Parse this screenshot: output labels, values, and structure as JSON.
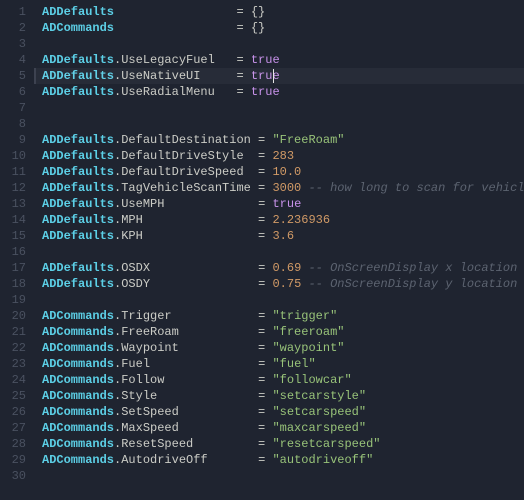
{
  "editor": {
    "cursor_line": 5,
    "cursor_col_ch": 33,
    "lines": [
      {
        "n": 1,
        "tokens": [
          {
            "t": "var",
            "v": "ADDefaults"
          },
          {
            "t": "sp",
            "v": "                 "
          },
          {
            "t": "eq",
            "v": "="
          },
          {
            "t": "sp",
            "v": " "
          },
          {
            "t": "punc",
            "v": "{}"
          }
        ]
      },
      {
        "n": 2,
        "tokens": [
          {
            "t": "var",
            "v": "ADCommands"
          },
          {
            "t": "sp",
            "v": "                 "
          },
          {
            "t": "eq",
            "v": "="
          },
          {
            "t": "sp",
            "v": " "
          },
          {
            "t": "punc",
            "v": "{}"
          }
        ]
      },
      {
        "n": 3,
        "tokens": []
      },
      {
        "n": 4,
        "tokens": [
          {
            "t": "var",
            "v": "ADDefaults"
          },
          {
            "t": "punc",
            "v": "."
          },
          {
            "t": "prop",
            "v": "UseLegacyFuel"
          },
          {
            "t": "sp",
            "v": "   "
          },
          {
            "t": "eq",
            "v": "="
          },
          {
            "t": "sp",
            "v": " "
          },
          {
            "t": "bool",
            "v": "true"
          }
        ]
      },
      {
        "n": 5,
        "tokens": [
          {
            "t": "var",
            "v": "ADDefaults"
          },
          {
            "t": "punc",
            "v": "."
          },
          {
            "t": "prop",
            "v": "UseNativeUI"
          },
          {
            "t": "sp",
            "v": "     "
          },
          {
            "t": "eq",
            "v": "="
          },
          {
            "t": "sp",
            "v": " "
          },
          {
            "t": "bool",
            "v": "true"
          }
        ]
      },
      {
        "n": 6,
        "tokens": [
          {
            "t": "var",
            "v": "ADDefaults"
          },
          {
            "t": "punc",
            "v": "."
          },
          {
            "t": "prop",
            "v": "UseRadialMenu"
          },
          {
            "t": "sp",
            "v": "   "
          },
          {
            "t": "eq",
            "v": "="
          },
          {
            "t": "sp",
            "v": " "
          },
          {
            "t": "bool",
            "v": "true"
          }
        ]
      },
      {
        "n": 7,
        "tokens": []
      },
      {
        "n": 8,
        "tokens": []
      },
      {
        "n": 9,
        "tokens": [
          {
            "t": "var",
            "v": "ADDefaults"
          },
          {
            "t": "punc",
            "v": "."
          },
          {
            "t": "prop",
            "v": "DefaultDestination"
          },
          {
            "t": "sp",
            "v": " "
          },
          {
            "t": "eq",
            "v": "="
          },
          {
            "t": "sp",
            "v": " "
          },
          {
            "t": "str",
            "v": "\"FreeRoam\""
          }
        ]
      },
      {
        "n": 10,
        "tokens": [
          {
            "t": "var",
            "v": "ADDefaults"
          },
          {
            "t": "punc",
            "v": "."
          },
          {
            "t": "prop",
            "v": "DefaultDriveStyle"
          },
          {
            "t": "sp",
            "v": "  "
          },
          {
            "t": "eq",
            "v": "="
          },
          {
            "t": "sp",
            "v": " "
          },
          {
            "t": "num",
            "v": "283"
          }
        ]
      },
      {
        "n": 11,
        "tokens": [
          {
            "t": "var",
            "v": "ADDefaults"
          },
          {
            "t": "punc",
            "v": "."
          },
          {
            "t": "prop",
            "v": "DefaultDriveSpeed"
          },
          {
            "t": "sp",
            "v": "  "
          },
          {
            "t": "eq",
            "v": "="
          },
          {
            "t": "sp",
            "v": " "
          },
          {
            "t": "num",
            "v": "10.0"
          }
        ]
      },
      {
        "n": 12,
        "tokens": [
          {
            "t": "var",
            "v": "ADDefaults"
          },
          {
            "t": "punc",
            "v": "."
          },
          {
            "t": "prop",
            "v": "TagVehicleScanTime"
          },
          {
            "t": "sp",
            "v": " "
          },
          {
            "t": "eq",
            "v": "="
          },
          {
            "t": "sp",
            "v": " "
          },
          {
            "t": "num",
            "v": "3000"
          },
          {
            "t": "sp",
            "v": " "
          },
          {
            "t": "com",
            "v": "-- how long to scan for vehicles"
          }
        ]
      },
      {
        "n": 13,
        "tokens": [
          {
            "t": "var",
            "v": "ADDefaults"
          },
          {
            "t": "punc",
            "v": "."
          },
          {
            "t": "prop",
            "v": "UseMPH"
          },
          {
            "t": "sp",
            "v": "             "
          },
          {
            "t": "eq",
            "v": "="
          },
          {
            "t": "sp",
            "v": " "
          },
          {
            "t": "bool",
            "v": "true"
          }
        ]
      },
      {
        "n": 14,
        "tokens": [
          {
            "t": "var",
            "v": "ADDefaults"
          },
          {
            "t": "punc",
            "v": "."
          },
          {
            "t": "prop",
            "v": "MPH"
          },
          {
            "t": "sp",
            "v": "                "
          },
          {
            "t": "eq",
            "v": "="
          },
          {
            "t": "sp",
            "v": " "
          },
          {
            "t": "num",
            "v": "2.236936"
          }
        ]
      },
      {
        "n": 15,
        "tokens": [
          {
            "t": "var",
            "v": "ADDefaults"
          },
          {
            "t": "punc",
            "v": "."
          },
          {
            "t": "prop",
            "v": "KPH"
          },
          {
            "t": "sp",
            "v": "                "
          },
          {
            "t": "eq",
            "v": "="
          },
          {
            "t": "sp",
            "v": " "
          },
          {
            "t": "num",
            "v": "3.6"
          }
        ]
      },
      {
        "n": 16,
        "tokens": []
      },
      {
        "n": 17,
        "tokens": [
          {
            "t": "var",
            "v": "ADDefaults"
          },
          {
            "t": "punc",
            "v": "."
          },
          {
            "t": "prop",
            "v": "OSDX"
          },
          {
            "t": "sp",
            "v": "               "
          },
          {
            "t": "eq",
            "v": "="
          },
          {
            "t": "sp",
            "v": " "
          },
          {
            "t": "num",
            "v": "0.69"
          },
          {
            "t": "sp",
            "v": " "
          },
          {
            "t": "com",
            "v": "-- OnScreenDisplay x location"
          }
        ]
      },
      {
        "n": 18,
        "tokens": [
          {
            "t": "var",
            "v": "ADDefaults"
          },
          {
            "t": "punc",
            "v": "."
          },
          {
            "t": "prop",
            "v": "OSDY"
          },
          {
            "t": "sp",
            "v": "               "
          },
          {
            "t": "eq",
            "v": "="
          },
          {
            "t": "sp",
            "v": " "
          },
          {
            "t": "num",
            "v": "0.75"
          },
          {
            "t": "sp",
            "v": " "
          },
          {
            "t": "com",
            "v": "-- OnScreenDisplay y location"
          }
        ]
      },
      {
        "n": 19,
        "tokens": []
      },
      {
        "n": 20,
        "tokens": [
          {
            "t": "var",
            "v": "ADCommands"
          },
          {
            "t": "punc",
            "v": "."
          },
          {
            "t": "prop",
            "v": "Trigger"
          },
          {
            "t": "sp",
            "v": "            "
          },
          {
            "t": "eq",
            "v": "="
          },
          {
            "t": "sp",
            "v": " "
          },
          {
            "t": "str",
            "v": "\"trigger\""
          }
        ]
      },
      {
        "n": 21,
        "tokens": [
          {
            "t": "var",
            "v": "ADCommands"
          },
          {
            "t": "punc",
            "v": "."
          },
          {
            "t": "prop",
            "v": "FreeRoam"
          },
          {
            "t": "sp",
            "v": "           "
          },
          {
            "t": "eq",
            "v": "="
          },
          {
            "t": "sp",
            "v": " "
          },
          {
            "t": "str",
            "v": "\"freeroam\""
          }
        ]
      },
      {
        "n": 22,
        "tokens": [
          {
            "t": "var",
            "v": "ADCommands"
          },
          {
            "t": "punc",
            "v": "."
          },
          {
            "t": "prop",
            "v": "Waypoint"
          },
          {
            "t": "sp",
            "v": "           "
          },
          {
            "t": "eq",
            "v": "="
          },
          {
            "t": "sp",
            "v": " "
          },
          {
            "t": "str",
            "v": "\"waypoint\""
          }
        ]
      },
      {
        "n": 23,
        "tokens": [
          {
            "t": "var",
            "v": "ADCommands"
          },
          {
            "t": "punc",
            "v": "."
          },
          {
            "t": "prop",
            "v": "Fuel"
          },
          {
            "t": "sp",
            "v": "               "
          },
          {
            "t": "eq",
            "v": "="
          },
          {
            "t": "sp",
            "v": " "
          },
          {
            "t": "str",
            "v": "\"fuel\""
          }
        ]
      },
      {
        "n": 24,
        "tokens": [
          {
            "t": "var",
            "v": "ADCommands"
          },
          {
            "t": "punc",
            "v": "."
          },
          {
            "t": "prop",
            "v": "Follow"
          },
          {
            "t": "sp",
            "v": "             "
          },
          {
            "t": "eq",
            "v": "="
          },
          {
            "t": "sp",
            "v": " "
          },
          {
            "t": "str",
            "v": "\"followcar\""
          }
        ]
      },
      {
        "n": 25,
        "tokens": [
          {
            "t": "var",
            "v": "ADCommands"
          },
          {
            "t": "punc",
            "v": "."
          },
          {
            "t": "prop",
            "v": "Style"
          },
          {
            "t": "sp",
            "v": "              "
          },
          {
            "t": "eq",
            "v": "="
          },
          {
            "t": "sp",
            "v": " "
          },
          {
            "t": "str",
            "v": "\"setcarstyle\""
          }
        ]
      },
      {
        "n": 26,
        "tokens": [
          {
            "t": "var",
            "v": "ADCommands"
          },
          {
            "t": "punc",
            "v": "."
          },
          {
            "t": "prop",
            "v": "SetSpeed"
          },
          {
            "t": "sp",
            "v": "           "
          },
          {
            "t": "eq",
            "v": "="
          },
          {
            "t": "sp",
            "v": " "
          },
          {
            "t": "str",
            "v": "\"setcarspeed\""
          }
        ]
      },
      {
        "n": 27,
        "tokens": [
          {
            "t": "var",
            "v": "ADCommands"
          },
          {
            "t": "punc",
            "v": "."
          },
          {
            "t": "prop",
            "v": "MaxSpeed"
          },
          {
            "t": "sp",
            "v": "           "
          },
          {
            "t": "eq",
            "v": "="
          },
          {
            "t": "sp",
            "v": " "
          },
          {
            "t": "str",
            "v": "\"maxcarspeed\""
          }
        ]
      },
      {
        "n": 28,
        "tokens": [
          {
            "t": "var",
            "v": "ADCommands"
          },
          {
            "t": "punc",
            "v": "."
          },
          {
            "t": "prop",
            "v": "ResetSpeed"
          },
          {
            "t": "sp",
            "v": "         "
          },
          {
            "t": "eq",
            "v": "="
          },
          {
            "t": "sp",
            "v": " "
          },
          {
            "t": "str",
            "v": "\"resetcarspeed\""
          }
        ]
      },
      {
        "n": 29,
        "tokens": [
          {
            "t": "var",
            "v": "ADCommands"
          },
          {
            "t": "punc",
            "v": "."
          },
          {
            "t": "prop",
            "v": "AutodriveOff"
          },
          {
            "t": "sp",
            "v": "       "
          },
          {
            "t": "eq",
            "v": "="
          },
          {
            "t": "sp",
            "v": " "
          },
          {
            "t": "str",
            "v": "\"autodriveoff\""
          }
        ]
      },
      {
        "n": 30,
        "tokens": []
      }
    ]
  }
}
